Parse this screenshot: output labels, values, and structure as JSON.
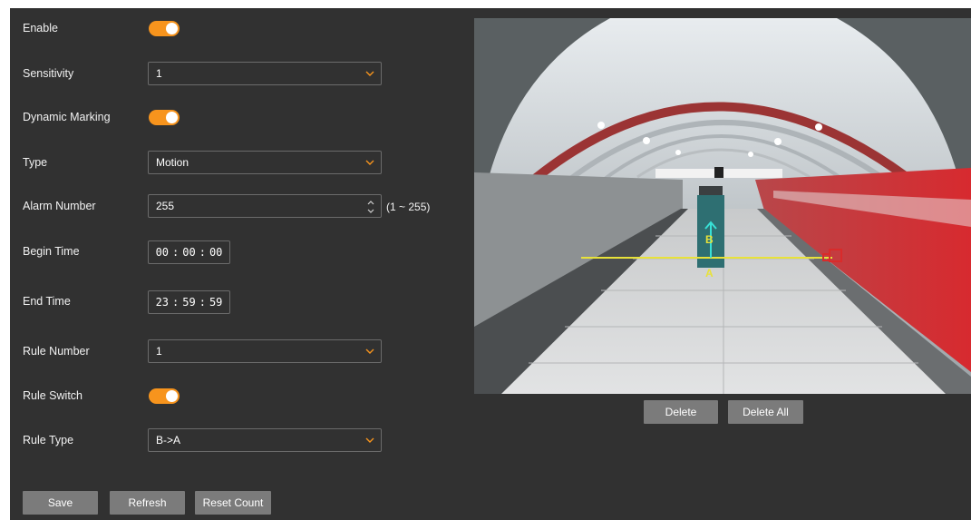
{
  "form": {
    "enable_label": "Enable",
    "sensitivity_label": "Sensitivity",
    "sensitivity_value": "1",
    "dynamic_marking_label": "Dynamic Marking",
    "type_label": "Type",
    "type_value": "Motion",
    "alarm_number_label": "Alarm Number",
    "alarm_number_value": "255",
    "alarm_number_range": "(1 ~ 255)",
    "begin_time_label": "Begin Time",
    "begin_time": {
      "h": "00",
      "m": "00",
      "s": "00"
    },
    "end_time_label": "End Time",
    "end_time": {
      "h": "23",
      "m": "59",
      "s": "59"
    },
    "rule_number_label": "Rule Number",
    "rule_number_value": "1",
    "rule_switch_label": "Rule Switch",
    "rule_type_label": "Rule Type",
    "rule_type_value": "B->A",
    "time_sep": ":"
  },
  "toggles": {
    "enable": true,
    "dynamic_marking": true,
    "rule_switch": true
  },
  "buttons": {
    "save": "Save",
    "refresh": "Refresh",
    "reset_count": "Reset Count",
    "delete": "Delete",
    "delete_all": "Delete All"
  },
  "overlay": {
    "point_a": "A",
    "point_b": "B"
  },
  "colors": {
    "accent": "#f7941d",
    "panel": "#313131",
    "button": "#7b7b7b",
    "rule_line": "#e8e23a",
    "direction_arrow": "#38e0d6"
  }
}
